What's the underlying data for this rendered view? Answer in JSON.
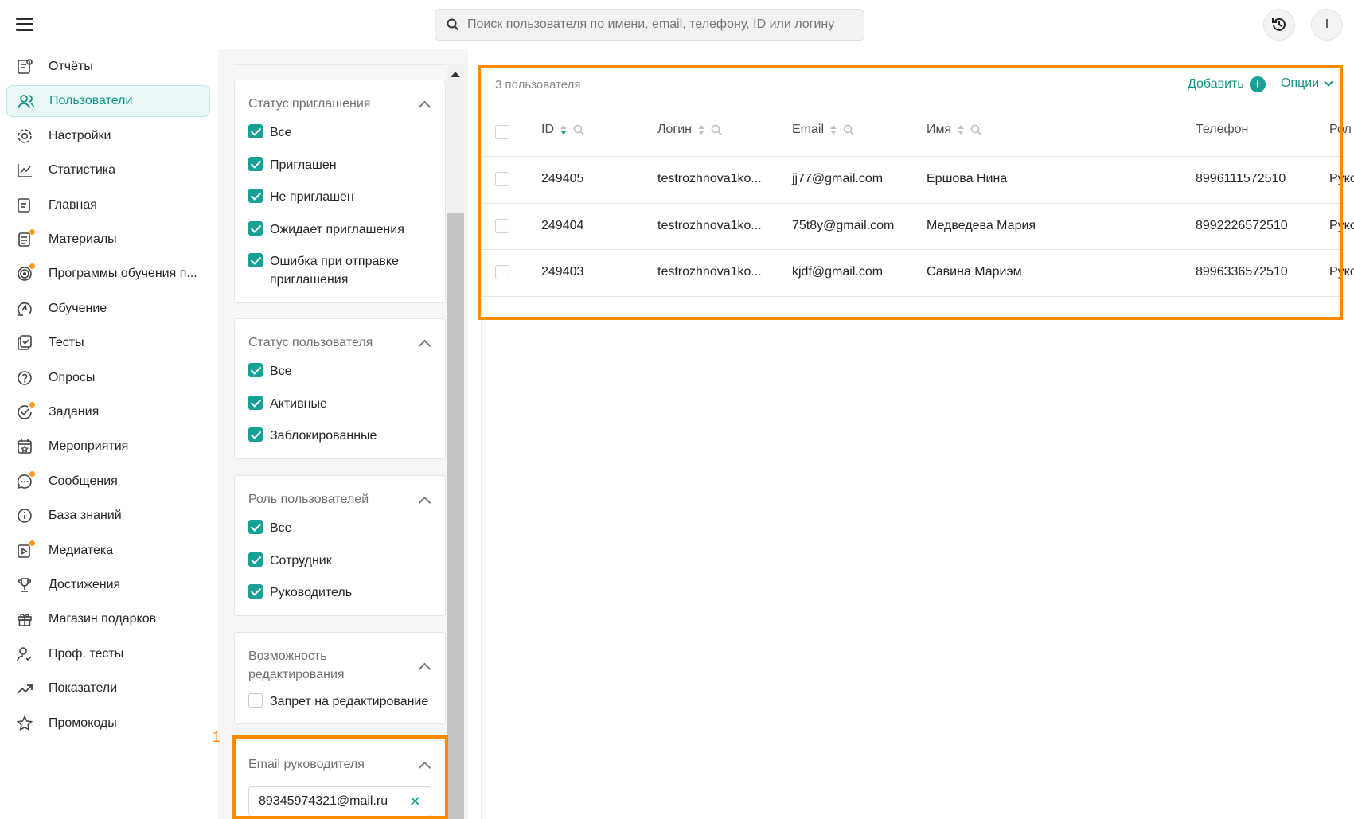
{
  "search": {
    "placeholder": "Поиск пользователя по имени, email, телефону, ID или логину"
  },
  "header": {
    "avatar_letter": "I"
  },
  "sidebar": {
    "items": [
      {
        "label": "Отчёты",
        "icon": "reports-icon"
      },
      {
        "label": "Пользователи",
        "icon": "users-icon",
        "active": true
      },
      {
        "label": "Настройки",
        "icon": "gear-icon"
      },
      {
        "label": "Статистика",
        "icon": "chart-icon"
      },
      {
        "label": "Главная",
        "icon": "home-icon"
      },
      {
        "label": "Материалы",
        "icon": "materials-icon",
        "dot": true
      },
      {
        "label": "Программы обучения п...",
        "icon": "programs-icon",
        "dot": true
      },
      {
        "label": "Обучение",
        "icon": "learning-icon"
      },
      {
        "label": "Тесты",
        "icon": "tests-icon"
      },
      {
        "label": "Опросы",
        "icon": "surveys-icon"
      },
      {
        "label": "Задания",
        "icon": "tasks-icon",
        "dot": true
      },
      {
        "label": "Мероприятия",
        "icon": "events-icon"
      },
      {
        "label": "Сообщения",
        "icon": "messages-icon",
        "dot": true
      },
      {
        "label": "База знаний",
        "icon": "info-icon"
      },
      {
        "label": "Медиатека",
        "icon": "media-icon",
        "dot": true
      },
      {
        "label": "Достижения",
        "icon": "trophy-icon"
      },
      {
        "label": "Магазин подарков",
        "icon": "gift-icon"
      },
      {
        "label": "Проф. тесты",
        "icon": "prof-tests-icon"
      },
      {
        "label": "Показатели",
        "icon": "trend-icon"
      },
      {
        "label": "Промокоды",
        "icon": "star-icon"
      }
    ]
  },
  "filters": {
    "invite_status": {
      "title": "Статус приглашения",
      "options": [
        {
          "label": "Все",
          "checked": true
        },
        {
          "label": "Приглашен",
          "checked": true
        },
        {
          "label": "Не приглашен",
          "checked": true
        },
        {
          "label": "Ожидает приглашения",
          "checked": true
        },
        {
          "label": "Ошибка при отправке приглашения",
          "checked": true
        }
      ]
    },
    "user_status": {
      "title": "Статус пользователя",
      "options": [
        {
          "label": "Все",
          "checked": true
        },
        {
          "label": "Активные",
          "checked": true
        },
        {
          "label": "Заблокированные",
          "checked": true
        }
      ]
    },
    "user_role": {
      "title": "Роль пользователей",
      "options": [
        {
          "label": "Все",
          "checked": true
        },
        {
          "label": "Сотрудник",
          "checked": true
        },
        {
          "label": "Руководитель",
          "checked": true
        }
      ]
    },
    "editing": {
      "title": "Возможность редактирования",
      "options": [
        {
          "label": "Запрет на редактирование",
          "checked": false
        }
      ]
    },
    "manager_email": {
      "title": "Email руководителя",
      "value": "89345974321@mail.ru"
    },
    "annotation_marker": "1"
  },
  "table": {
    "count_label": "3 пользователя",
    "add_label": "Добавить",
    "options_label": "Опции",
    "columns": [
      "ID",
      "Логин",
      "Email",
      "Имя",
      "Телефон",
      "Рол"
    ],
    "rows": [
      {
        "id": "249405",
        "login": "testrozhnova1ko...",
        "email": "jj77@gmail.com",
        "name": "Ершова Нина",
        "phone": "8996111572510",
        "role": "Руко"
      },
      {
        "id": "249404",
        "login": "testrozhnova1ko...",
        "email": "75t8y@gmail.com",
        "name": "Медведева Мария",
        "phone": "8992226572510",
        "role": "Руко"
      },
      {
        "id": "249403",
        "login": "testrozhnova1ko...",
        "email": "kjdf@gmail.com",
        "name": "Савина Мариэм",
        "phone": "8996336572510",
        "role": "Руко"
      }
    ]
  },
  "colors": {
    "accent": "#16a096",
    "highlight": "#ff8a00"
  }
}
